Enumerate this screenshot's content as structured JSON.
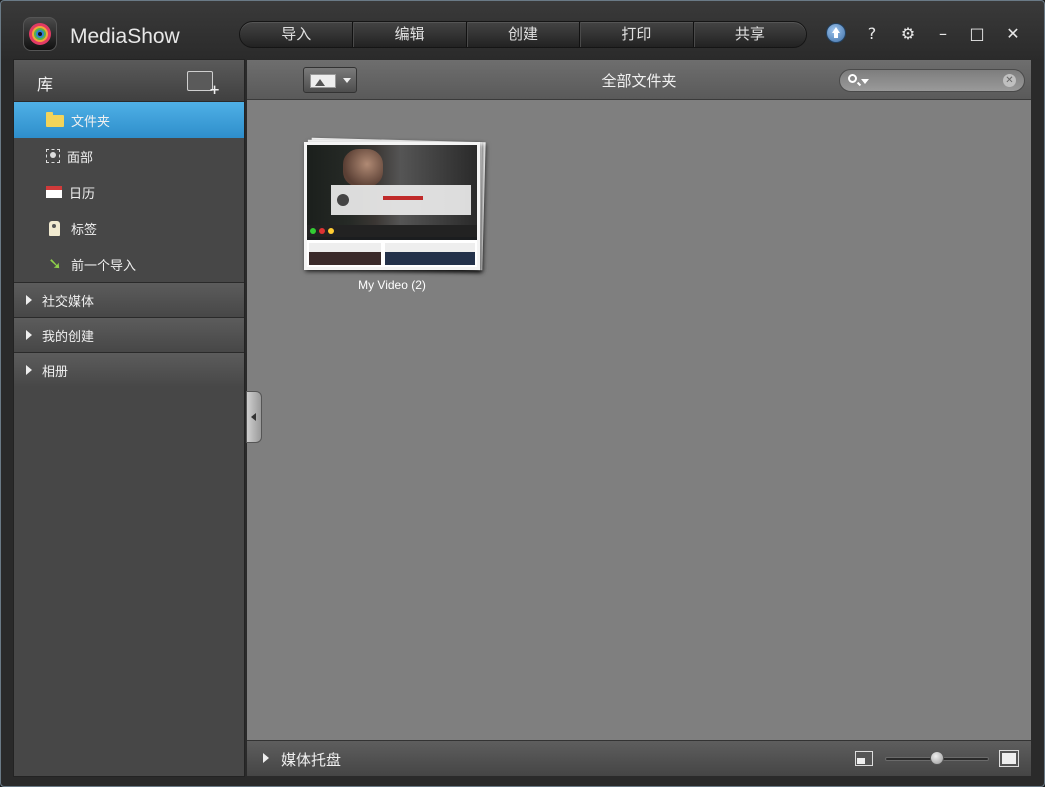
{
  "app": {
    "title": "MediaShow"
  },
  "nav": [
    "导入",
    "编辑",
    "创建",
    "打印",
    "共享"
  ],
  "window_controls": {
    "help": "?",
    "settings": "⚙",
    "minimize": "–",
    "maximize": "□",
    "close": "✕"
  },
  "library": {
    "title": "库",
    "items": [
      {
        "label": "文件夹",
        "icon": "folder-icon",
        "active": true
      },
      {
        "label": "面部",
        "icon": "face-icon",
        "active": false
      },
      {
        "label": "日历",
        "icon": "calendar-icon",
        "active": false
      },
      {
        "label": "标签",
        "icon": "tag-icon",
        "active": false
      },
      {
        "label": "前一个导入",
        "icon": "previous-import-icon",
        "active": false
      }
    ],
    "sections": [
      "社交媒体",
      "我的创建",
      "相册"
    ]
  },
  "main": {
    "title": "全部文件夹",
    "search": {
      "placeholder": ""
    },
    "folders": [
      {
        "label": "My Video (2)"
      }
    ]
  },
  "tray": {
    "label": "媒体托盘",
    "thumbnail_size": 0.5
  },
  "colors": {
    "active_item": "#3a9ed8",
    "content_bg": "#7f7f7f"
  }
}
